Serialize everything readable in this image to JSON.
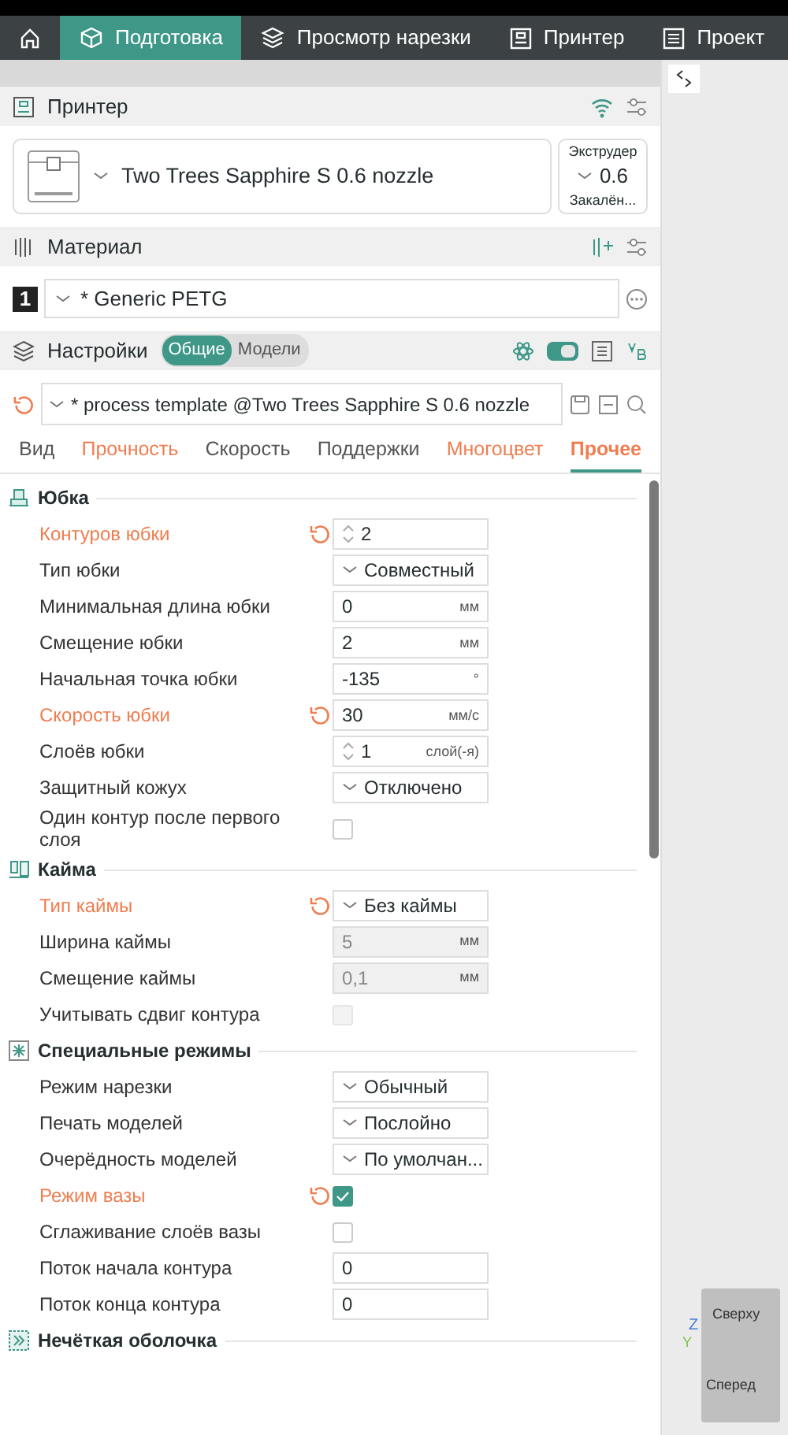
{
  "top_tabs": [
    {
      "kind": "home",
      "selected": false
    },
    {
      "label": "Подготовка",
      "kind": "cube",
      "selected": true
    },
    {
      "label": "Просмотр нарезки",
      "kind": "layers",
      "selected": false
    },
    {
      "label": "Принтер",
      "kind": "printer",
      "selected": false
    },
    {
      "label": "Проект",
      "kind": "list",
      "selected": false
    }
  ],
  "printer": {
    "title": "Принтер",
    "name": "Two Trees Sapphire S 0.6 nozzle",
    "extruder": {
      "title": "Экструдер",
      "diameter": "0.6",
      "type": "Закалён..."
    }
  },
  "material": {
    "title": "Материал",
    "filaments": [
      {
        "index": "1",
        "name": "* Generic PETG",
        "color": "#222222"
      }
    ]
  },
  "settings": {
    "title": "Настройки",
    "scope": [
      {
        "label": "Общие",
        "selected": true
      },
      {
        "label": "Модели",
        "selected": false
      }
    ],
    "advanced": true,
    "process": "* process template @Two Trees Sapphire S 0.6 nozzle",
    "tabs": [
      {
        "label": "Вид",
        "modified": false,
        "selected": false
      },
      {
        "label": "Прочность",
        "modified": true,
        "selected": false
      },
      {
        "label": "Скорость",
        "modified": false,
        "selected": false
      },
      {
        "label": "Поддержки",
        "modified": false,
        "selected": false
      },
      {
        "label": "Многоцвет",
        "modified": true,
        "selected": false
      },
      {
        "label": "Прочее",
        "modified": true,
        "selected": true
      }
    ]
  },
  "groups": [
    {
      "title": "Юбка",
      "rows": [
        {
          "label": "Контуров юбки",
          "kind": "spin",
          "value": "2",
          "modified": true
        },
        {
          "label": "Тип юбки",
          "kind": "combo",
          "value": "Совместный",
          "modified": false
        },
        {
          "label": "Минимальная длина юбки",
          "kind": "number",
          "value": "0",
          "unit": "мм",
          "modified": false
        },
        {
          "label": "Смещение юбки",
          "kind": "number",
          "value": "2",
          "unit": "мм",
          "modified": false
        },
        {
          "label": "Начальная точка юбки",
          "kind": "number",
          "value": "-135",
          "unit": "°",
          "modified": false
        },
        {
          "label": "Скорость юбки",
          "kind": "number",
          "value": "30",
          "unit": "мм/с",
          "modified": true
        },
        {
          "label": "Слоёв юбки",
          "kind": "spin",
          "value": "1",
          "unit": "слой(-я)",
          "modified": false
        },
        {
          "label": "Защитный кожух",
          "kind": "combo",
          "value": "Отключено",
          "modified": false
        },
        {
          "label": "Один контур после первого слоя",
          "kind": "check",
          "checked": false,
          "modified": false
        }
      ]
    },
    {
      "title": "Кайма",
      "rows": [
        {
          "label": "Тип каймы",
          "kind": "combo",
          "value": "Без каймы",
          "modified": true
        },
        {
          "label": "Ширина каймы",
          "kind": "number",
          "value": "5",
          "unit": "мм",
          "modified": false,
          "disabled": true
        },
        {
          "label": "Смещение каймы",
          "kind": "number",
          "value": "0,1",
          "unit": "мм",
          "modified": false,
          "disabled": true
        },
        {
          "label": "Учитывать сдвиг контура",
          "kind": "check",
          "checked": false,
          "modified": false,
          "disabled": true
        }
      ]
    },
    {
      "title": "Специальные режимы",
      "rows": [
        {
          "label": "Режим нарезки",
          "kind": "combo",
          "value": "Обычный",
          "modified": false
        },
        {
          "label": "Печать моделей",
          "kind": "combo",
          "value": "Послойно",
          "modified": false
        },
        {
          "label": "Очерёдность моделей",
          "kind": "combo",
          "value": "По умолчан...",
          "modified": false
        },
        {
          "label": "Режим вазы",
          "kind": "check",
          "checked": true,
          "modified": true
        },
        {
          "label": "Сглаживание слоёв вазы",
          "kind": "check",
          "checked": false,
          "modified": false
        },
        {
          "label": "Поток начала контура",
          "kind": "number",
          "value": "0",
          "modified": false
        },
        {
          "label": "Поток конца контура",
          "kind": "number",
          "value": "0",
          "modified": false
        }
      ]
    },
    {
      "title": "Нечёткая оболочка"
    }
  ],
  "view_cube": {
    "top": "Сверху",
    "front": "Сперед",
    "axis_z": "Z",
    "axis_y": "Y"
  }
}
